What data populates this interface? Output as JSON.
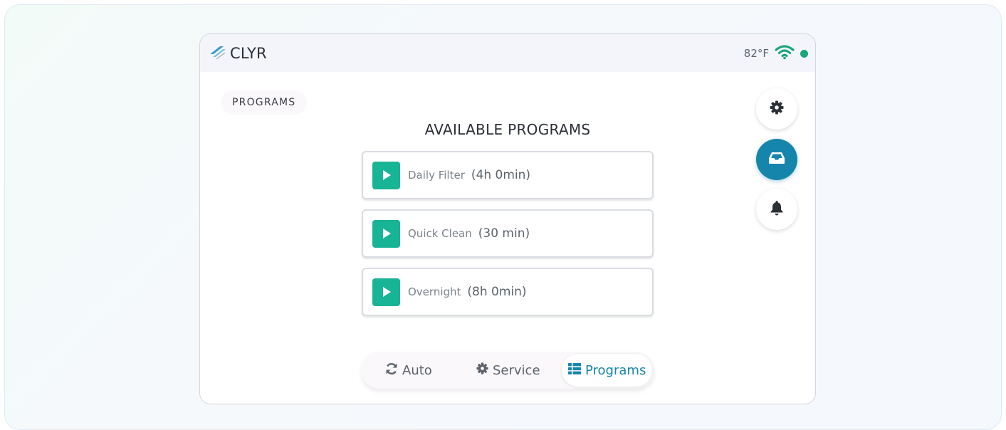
{
  "header": {
    "brand": "CLYR",
    "temperature": "82°F",
    "wifi": "wifi-icon",
    "status_color": "#1ba57a"
  },
  "section": {
    "label": "PROGRAMS"
  },
  "main": {
    "title": "AVAILABLE PROGRAMS",
    "programs": [
      {
        "name": "Daily Filter",
        "duration": "(4h 0min)"
      },
      {
        "name": "Quick Clean",
        "duration": "(30 min)"
      },
      {
        "name": "Overnight",
        "duration": "(8h 0min)"
      }
    ]
  },
  "side_nav": [
    {
      "icon": "gear-icon",
      "active": false
    },
    {
      "icon": "inbox-icon",
      "active": true
    },
    {
      "icon": "bell-icon",
      "active": false
    }
  ],
  "modes": [
    {
      "label": "Auto",
      "icon": "sync-icon",
      "active": false
    },
    {
      "label": "Service",
      "icon": "gear-icon",
      "active": false
    },
    {
      "label": "Programs",
      "icon": "list-icon",
      "active": true
    }
  ],
  "colors": {
    "accent": "#1685ab",
    "play": "#17b495"
  }
}
